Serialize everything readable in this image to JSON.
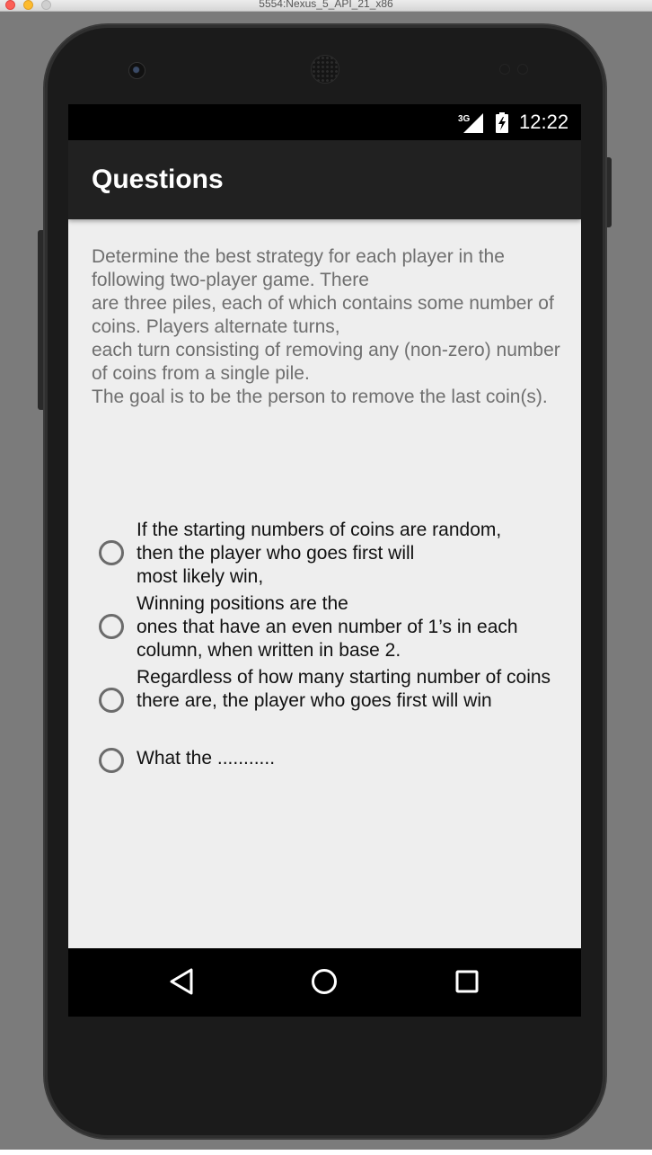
{
  "window": {
    "title": "5554:Nexus_5_API_21_x86"
  },
  "statusbar": {
    "network": "3G",
    "time": "12:22"
  },
  "appbar": {
    "title": "Questions"
  },
  "question": {
    "text": "Determine the best strategy for each player in the following two-player game. There\nare three piles, each of which contains some number of coins. Players alternate turns,\neach turn consisting of removing any (non-zero) number of coins from a single pile.\nThe goal is to be the person to remove the last coin(s)."
  },
  "options": [
    {
      "text": "If the starting numbers of coins are random,\nthen the player who goes first will\nmost likely win,",
      "selected": false
    },
    {
      "text": "Winning positions are the\nones that have an even number of 1’s in each column, when written in base 2.",
      "selected": false
    },
    {
      "text": "Regardless of how many starting number of coins there are, the player who goes first will win",
      "selected": false
    },
    {
      "text": "What the ...........",
      "selected": false
    }
  ],
  "navbar": {
    "back_icon": "back-triangle-icon",
    "home_icon": "home-circle-icon",
    "recents_icon": "recents-square-icon"
  }
}
